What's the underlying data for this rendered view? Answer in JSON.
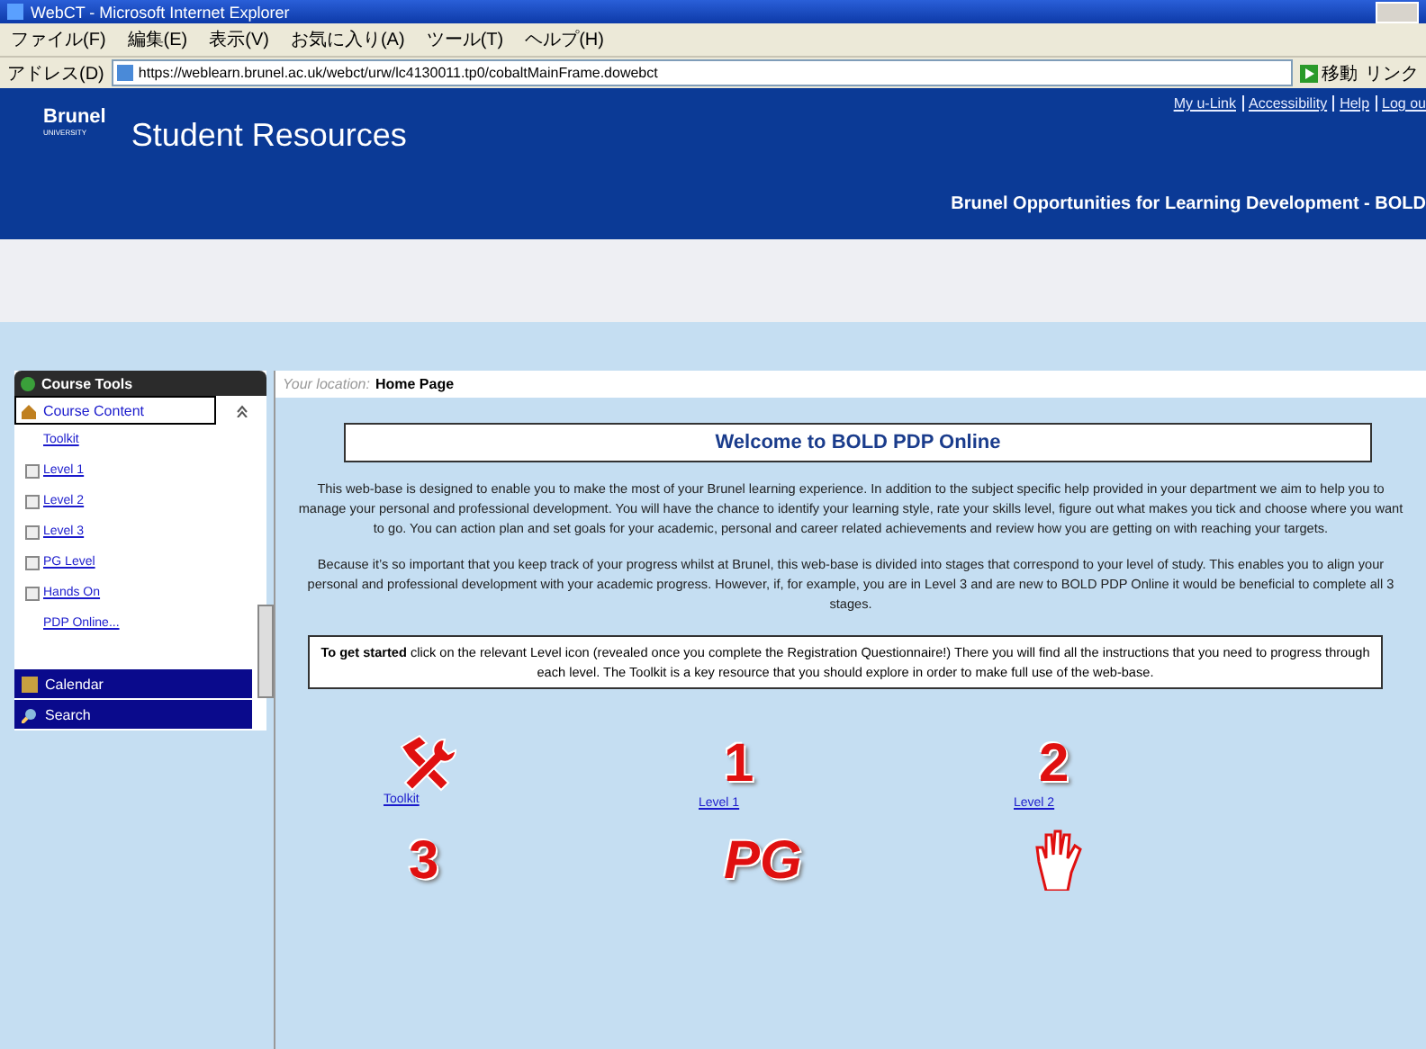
{
  "window": {
    "title": "WebCT - Microsoft Internet Explorer"
  },
  "menu": [
    "ファイル(F)",
    "編集(E)",
    "表示(V)",
    "お気に入り(A)",
    "ツール(T)",
    "ヘルプ(H)"
  ],
  "address_bar": {
    "label": "アドレス(D)",
    "url": "https://weblearn.brunel.ac.uk/webct/urw/lc4130011.tp0/cobaltMainFrame.dowebct",
    "go": "移動",
    "links": "リンク"
  },
  "header": {
    "logo": "Brunel",
    "logo_sub": "UNIVERSITY",
    "title": "Student Resources",
    "links": [
      "My u-Link",
      "Accessibility",
      "Help",
      "Log ou"
    ],
    "subtitle": "Brunel Opportunities for Learning Development - BOLD"
  },
  "sidebar": {
    "title": "Course Tools",
    "section": "Course Content",
    "items": [
      {
        "label": "Toolkit",
        "kind": "leaf"
      },
      {
        "label": "Level 1",
        "kind": "folder"
      },
      {
        "label": "Level 2",
        "kind": "folder"
      },
      {
        "label": "Level 3",
        "kind": "folder"
      },
      {
        "label": "PG Level",
        "kind": "folder"
      },
      {
        "label": "Hands On",
        "kind": "folder"
      },
      {
        "label": "PDP Online...",
        "kind": "leaf"
      }
    ],
    "tools": [
      {
        "label": "Calendar",
        "kind": "calendar"
      },
      {
        "label": "Search",
        "kind": "search"
      }
    ]
  },
  "location": {
    "label": "Your location:",
    "value": "Home Page"
  },
  "welcome": "Welcome to BOLD PDP Online",
  "paragraphs": [
    "This web-base is designed to enable you to make the most of your Brunel learning experience. In addition to the subject specific help provided in your department we aim to help you to manage your personal and professional development. You will have the chance to identify your learning style, rate your skills level, figure out what makes you tick and choose where you want to go. You can action plan and set goals for your academic, personal and career related achievements and review how you are getting on with reaching your targets.",
    "Because it’s so important that you keep track of your progress whilst at Brunel, this web-base is divided into stages that correspond to your level of study. This enables you to align your personal and professional development with your academic progress. However, if, for example, you are in Level 3 and are new to BOLD PDP Online it would be beneficial to complete all 3 stages."
  ],
  "notice": "**To get started** click on the relevant Level icon (revealed once you complete the Registration Questionnaire!) There you will find all the instructions that you need to progress through each level. The Toolkit is a key resource that you should explore in order to make full use of the web-base.",
  "tiles": [
    {
      "kind": "tools",
      "label": "Toolkit"
    },
    {
      "kind": "glyph",
      "glyph": "1",
      "label": "Level 1"
    },
    {
      "kind": "glyph",
      "glyph": "2",
      "label": "Level 2"
    },
    {
      "kind": "glyph",
      "glyph": "3"
    },
    {
      "kind": "glyph",
      "glyph": "PG",
      "italic": true
    },
    {
      "kind": "hand"
    }
  ]
}
